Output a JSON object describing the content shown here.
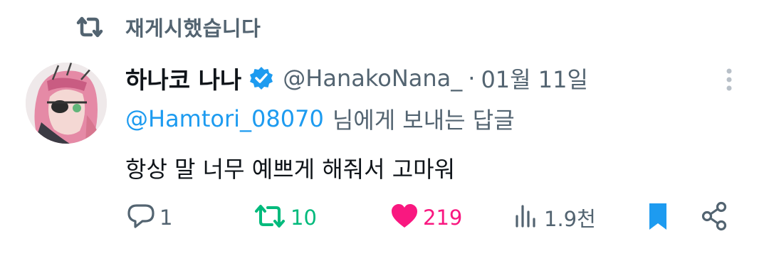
{
  "repost_header": {
    "icon": "repost-icon",
    "label": "재게시했습니다"
  },
  "tweet": {
    "author": {
      "display_name": "하나코 나나",
      "handle": "@HanakoNana_",
      "verified": true,
      "verified_color": "#1d9bf0"
    },
    "separator": "·",
    "timestamp": "01월 11일",
    "reply_to": {
      "mention": "@Hamtori_08070",
      "suffix": "님에게 보내는 답글"
    },
    "text": "항상 말 너무 예쁘게 해줘서 고마워"
  },
  "actions": {
    "reply": {
      "icon": "reply-icon",
      "count": "1"
    },
    "repost": {
      "icon": "repost-icon",
      "count": "10",
      "active": true,
      "color": "#00ba7c"
    },
    "like": {
      "icon": "heart-icon",
      "count": "219",
      "active": true,
      "color": "#f91880"
    },
    "views": {
      "icon": "views-icon",
      "count": "1.9천"
    },
    "bookmark": {
      "icon": "bookmark-icon",
      "active": true,
      "color": "#1d9bf0"
    },
    "share": {
      "icon": "share-icon"
    }
  },
  "more_icon": "more-vertical-icon"
}
